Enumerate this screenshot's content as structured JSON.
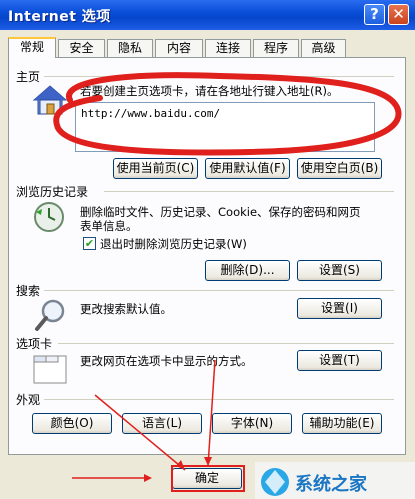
{
  "window": {
    "title": "Internet 选项",
    "help_glyph": "?",
    "close_glyph": "✕"
  },
  "tabs": [
    "常规",
    "安全",
    "隐私",
    "内容",
    "连接",
    "程序",
    "高级"
  ],
  "homepage": {
    "group_title": "主页",
    "description": "若要创建主页选项卡，请在各地址行键入地址(R)。",
    "url": "http://www.baidu.com/",
    "buttons": [
      "使用当前页(C)",
      "使用默认值(F)",
      "使用空白页(B)"
    ]
  },
  "history": {
    "group_title": "浏览历史记录",
    "description_line1": "删除临时文件、历史记录、Cookie、保存的密码和网页",
    "description_line2": "表单信息。",
    "checkbox_label": "退出时删除浏览历史记录(W)",
    "checkbox_checked": true,
    "delete_button": "删除(D)...",
    "settings_button": "设置(S)"
  },
  "search": {
    "group_title": "搜索",
    "description": "更改搜索默认值。",
    "settings_button": "设置(I)"
  },
  "tabs_section": {
    "group_title": "选项卡",
    "description": "更改网页在选项卡中显示的方式。",
    "settings_button": "设置(T)"
  },
  "appearance": {
    "group_title": "外观",
    "buttons": [
      "颜色(O)",
      "语言(L)",
      "字体(N)",
      "辅助功能(E)"
    ]
  },
  "footer": {
    "ok_button": "确定"
  },
  "watermark": {
    "text": "系统之家"
  },
  "colors": {
    "titlebar": "#0a4fd8",
    "annotation": "#e0201c",
    "tab_highlight": "#ffc83c"
  }
}
